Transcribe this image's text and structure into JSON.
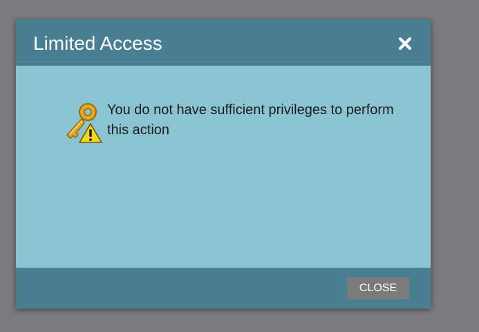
{
  "dialog": {
    "title": "Limited Access",
    "close_icon": "close-icon",
    "message": "You do not have sufficient privileges to perform this action",
    "message_icon": "key-warning-icon",
    "close_button_label": "CLOSE"
  },
  "colors": {
    "overlay": "#7b7b7d",
    "header": "#487f91",
    "body": "#8ac3d2",
    "footer": "#487f91",
    "button": "#7a7a7a",
    "key": "#d9a521",
    "warning": "#f6d31c"
  }
}
